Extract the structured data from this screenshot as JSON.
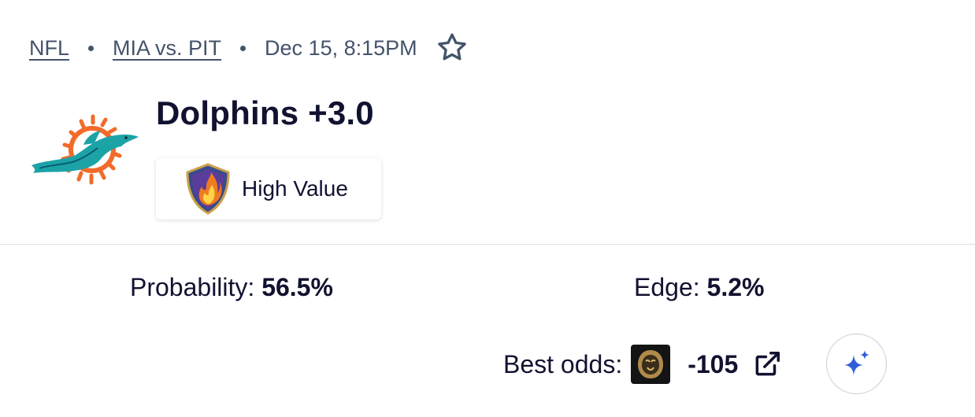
{
  "breadcrumb": {
    "league": "NFL",
    "matchup": "MIA vs. PIT",
    "datetime": "Dec 15, 8:15PM",
    "favorite_icon": "star-outline-icon"
  },
  "team": {
    "logo_icon": "miami-dolphins-logo",
    "pick_title": "Dolphins +3.0"
  },
  "badge": {
    "icon": "flame-shield-icon",
    "label": "High Value"
  },
  "stats": {
    "probability_label": "Probability:",
    "probability_value": "56.5%",
    "edge_label": "Edge:",
    "edge_value": "5.2%"
  },
  "best_odds": {
    "label": "Best odds:",
    "book_icon": "sportsbook-lion-logo",
    "value": "-105",
    "external_icon": "external-link-icon"
  },
  "ai_button": {
    "icon": "sparkle-icon"
  },
  "colors": {
    "text": "#111230",
    "muted": "#44536a",
    "accent": "#2f5fd6",
    "dolphin_teal": "#1ba3a6",
    "dolphin_orange": "#f26b2a"
  }
}
